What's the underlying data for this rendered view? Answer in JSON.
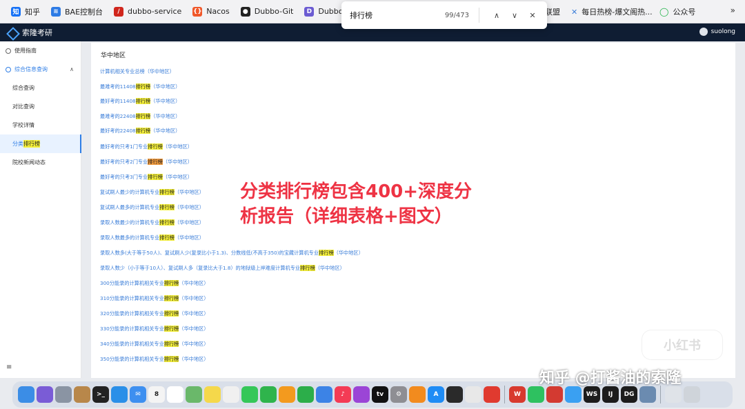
{
  "bookmarks": {
    "items": [
      {
        "label": "知乎",
        "icon": "zhihu-icon",
        "color": "#1772f6",
        "glyph": "知"
      },
      {
        "label": "BAE控制台",
        "icon": "wifi-icon",
        "color": "#2d7be5",
        "glyph": "≋"
      },
      {
        "label": "dubbo-service",
        "icon": "pen-icon",
        "color": "#d0261d",
        "glyph": "/"
      },
      {
        "label": "Nacos",
        "icon": "nacos-icon",
        "color": "#f0582a",
        "glyph": "{}"
      },
      {
        "label": "Dubbo-Git",
        "icon": "github-icon",
        "color": "#222222",
        "glyph": "●"
      },
      {
        "label": "Dubbo Admin",
        "icon": "dubbo-icon",
        "color": "#6b5bd2",
        "glyph": "D"
      }
    ],
    "right_items": [
      {
        "label": "联盟",
        "icon": "",
        "color": "",
        "glyph": ""
      },
      {
        "label": "每日热榜-爆文阁热...",
        "icon": "hotlist-icon",
        "color": "#3b7dd8",
        "glyph": "✕"
      },
      {
        "label": "公众号",
        "icon": "wechat-mp-icon",
        "color": "#22b34a",
        "glyph": "◯"
      }
    ],
    "more": "»"
  },
  "findbar": {
    "query": "排行榜",
    "count": "99/473",
    "prev": "∧",
    "next": "∨",
    "close": "✕"
  },
  "app": {
    "title": "索隆考研",
    "user": "suolong"
  },
  "sidebar": {
    "guide": "使用指南",
    "group": "综合信息查询",
    "items": [
      {
        "label": "综合查询",
        "active": false
      },
      {
        "label": "对比查询",
        "active": false
      },
      {
        "label": "学校详情",
        "active": false
      },
      {
        "label_pre": "分类",
        "label_hl": "排行榜",
        "active": true
      },
      {
        "label": "院校新闻动态",
        "active": false
      }
    ],
    "collapse_icon": "≡"
  },
  "main": {
    "region": "华中地区",
    "links": [
      {
        "pre": "计算机相关专业总榜（华中地区）",
        "hl": "",
        "post": ""
      },
      {
        "pre": "最难考的11408",
        "hl": "排行榜",
        "post": "（华中地区）"
      },
      {
        "pre": "最好考的11408",
        "hl": "排行榜",
        "post": "（华中地区）"
      },
      {
        "pre": "最难考的22408",
        "hl": "排行榜",
        "post": "（华中地区）"
      },
      {
        "pre": "最好考的22408",
        "hl": "排行榜",
        "post": "（华中地区）"
      },
      {
        "pre": "最好考的只考1门专业",
        "hl": "排行榜",
        "post": "（华中地区）"
      },
      {
        "pre": "最好考的只考2门专业",
        "hl": "排行榜",
        "post": "（华中地区）",
        "current": true
      },
      {
        "pre": "最好考的只考3门专业",
        "hl": "排行榜",
        "post": "（华中地区）"
      },
      {
        "pre": "复试刷人最少的计算机专业",
        "hl": "排行榜",
        "post": "（华中地区）"
      },
      {
        "pre": "复试刷人最多的计算机专业",
        "hl": "排行榜",
        "post": "（华中地区）"
      },
      {
        "pre": "录取人数最少的计算机专业",
        "hl": "排行榜",
        "post": "（华中地区）"
      },
      {
        "pre": "录取人数最多的计算机专业",
        "hl": "排行榜",
        "post": "（华中地区）"
      },
      {
        "pre": "录取人数多(大于等于50人)、复试刷人少(复录比小于1.3)、分数线低(不高于350)的宝藏计算机专业",
        "hl": "排行榜",
        "post": "（华中地区）"
      },
      {
        "pre": "录取人数少（小于等于10人）、复试刷人多（复录比大于1.8）的地狱级上岸难度计算机专业",
        "hl": "排行榜",
        "post": "（华中地区）"
      },
      {
        "pre": "300分能录的计算机相关专业",
        "hl": "排行榜",
        "post": "（华中地区）"
      },
      {
        "pre": "310分能录的计算机相关专业",
        "hl": "排行榜",
        "post": "（华中地区）"
      },
      {
        "pre": "320分能录的计算机相关专业",
        "hl": "排行榜",
        "post": "（华中地区）"
      },
      {
        "pre": "330分能录的计算机相关专业",
        "hl": "排行榜",
        "post": "（华中地区）"
      },
      {
        "pre": "340分能录的计算机相关专业",
        "hl": "排行榜",
        "post": "（华中地区）"
      },
      {
        "pre": "350分能录的计算机相关专业",
        "hl": "排行榜",
        "post": "（华中地区）"
      }
    ]
  },
  "overlay": {
    "line1": "分类排行榜包含400+深度分",
    "line2": "析报告（详细表格+图文）"
  },
  "watermarks": {
    "xiaohongshu": "小红书",
    "zhihu": "知乎 @打酱油的索隆"
  },
  "dock": {
    "calendar_day": "8",
    "apps": [
      {
        "icon": "finder-icon",
        "color": "#3b8de6",
        "glyph": ""
      },
      {
        "icon": "siri-icon",
        "color": "#7a5cd6",
        "glyph": ""
      },
      {
        "icon": "launchpad-icon",
        "color": "#8a94a3",
        "glyph": ""
      },
      {
        "icon": "archive-icon",
        "color": "#b8874a",
        "glyph": ""
      },
      {
        "icon": "terminal-icon",
        "color": "#222222",
        "glyph": ">_"
      },
      {
        "icon": "safari-icon",
        "color": "#2a8fe8",
        "glyph": ""
      },
      {
        "icon": "mail-icon",
        "color": "#3d8ff0",
        "glyph": "✉"
      },
      {
        "icon": "calendar-icon",
        "color": "#f4f4f4",
        "glyph": "8"
      },
      {
        "icon": "reminders-icon",
        "color": "#ffffff",
        "glyph": ""
      },
      {
        "icon": "maps-icon",
        "color": "#6ab86a",
        "glyph": ""
      },
      {
        "icon": "notes-icon",
        "color": "#f5d84b",
        "glyph": ""
      },
      {
        "icon": "photos-icon",
        "color": "#f0f0f0",
        "glyph": ""
      },
      {
        "icon": "messages-icon",
        "color": "#35c759",
        "glyph": ""
      },
      {
        "icon": "facetime-icon",
        "color": "#2fb44c",
        "glyph": ""
      },
      {
        "icon": "pages-icon",
        "color": "#f39a1e",
        "glyph": ""
      },
      {
        "icon": "numbers-icon",
        "color": "#2cae4a",
        "glyph": ""
      },
      {
        "icon": "keynote-icon",
        "color": "#3c83e6",
        "glyph": ""
      },
      {
        "icon": "music-icon",
        "color": "#f43b55",
        "glyph": "♪"
      },
      {
        "icon": "podcasts-icon",
        "color": "#9b45d6",
        "glyph": ""
      },
      {
        "icon": "tv-icon",
        "color": "#111111",
        "glyph": "tv"
      },
      {
        "icon": "system-settings-icon",
        "color": "#8e8e93",
        "glyph": "⚙"
      },
      {
        "icon": "books-icon",
        "color": "#f28b1e",
        "glyph": ""
      },
      {
        "icon": "app-store-icon",
        "color": "#1f8cf5",
        "glyph": "A"
      },
      {
        "icon": "navicat-icon",
        "color": "#2a2a2a",
        "glyph": ""
      },
      {
        "icon": "chrome-icon",
        "color": "#e8e8e8",
        "glyph": ""
      },
      {
        "icon": "xmind-icon",
        "color": "#e03a2f",
        "glyph": ""
      },
      {
        "icon": "wps-icon",
        "color": "#d83a2e",
        "glyph": "W"
      },
      {
        "icon": "wechat-icon",
        "color": "#2ec160",
        "glyph": ""
      },
      {
        "icon": "netease-icon",
        "color": "#d33a31",
        "glyph": ""
      },
      {
        "icon": "baidu-netdisk-icon",
        "color": "#3aa0f2",
        "glyph": ""
      },
      {
        "icon": "webstorm-icon",
        "color": "#1c1c1c",
        "glyph": "WS"
      },
      {
        "icon": "intellij-icon",
        "color": "#1c1c1c",
        "glyph": "IJ"
      },
      {
        "icon": "datagrip-icon",
        "color": "#1c1c1c",
        "glyph": "DG"
      },
      {
        "icon": "preview-icon",
        "color": "#6b8bb0",
        "glyph": ""
      },
      {
        "icon": "downloads-icon",
        "color": "#dfe3e8",
        "glyph": ""
      },
      {
        "icon": "trash-icon",
        "color": "#cfd4da",
        "glyph": ""
      }
    ]
  }
}
